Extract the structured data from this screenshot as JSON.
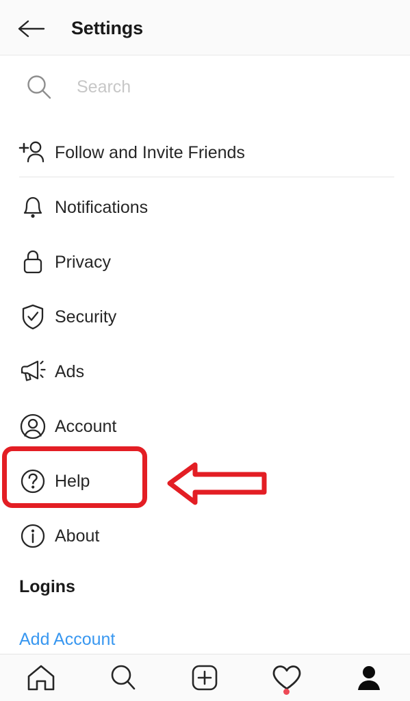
{
  "header": {
    "title": "Settings",
    "back_icon": "arrow-left-icon"
  },
  "search": {
    "placeholder": "Search",
    "value": "",
    "icon": "search-icon"
  },
  "menu": {
    "items": [
      {
        "label": "Follow and Invite Friends",
        "icon": "person-add-icon"
      },
      {
        "label": "Notifications",
        "icon": "bell-icon"
      },
      {
        "label": "Privacy",
        "icon": "lock-icon"
      },
      {
        "label": "Security",
        "icon": "shield-check-icon"
      },
      {
        "label": "Ads",
        "icon": "megaphone-icon"
      },
      {
        "label": "Account",
        "icon": "person-circle-icon"
      },
      {
        "label": "Help",
        "icon": "question-circle-icon"
      },
      {
        "label": "About",
        "icon": "info-circle-icon"
      }
    ]
  },
  "logins": {
    "section_title": "Logins",
    "add_account_label": "Add Account"
  },
  "annotation": {
    "color": "#e31e24",
    "highlight_target": "Help",
    "arrow_icon": "arrow-left-block-icon",
    "arrow_direction": "left"
  },
  "bottom_nav": {
    "items": [
      {
        "icon": "home-icon",
        "badge": false
      },
      {
        "icon": "search-icon",
        "badge": false
      },
      {
        "icon": "add-post-icon",
        "badge": false
      },
      {
        "icon": "heart-icon",
        "badge": true
      },
      {
        "icon": "profile-icon",
        "badge": false
      }
    ]
  },
  "colors": {
    "text": "#262626",
    "link": "#3897f0",
    "annotation_red": "#e31e24",
    "badge_red": "#ed4956",
    "header_bg": "#fafafa"
  }
}
